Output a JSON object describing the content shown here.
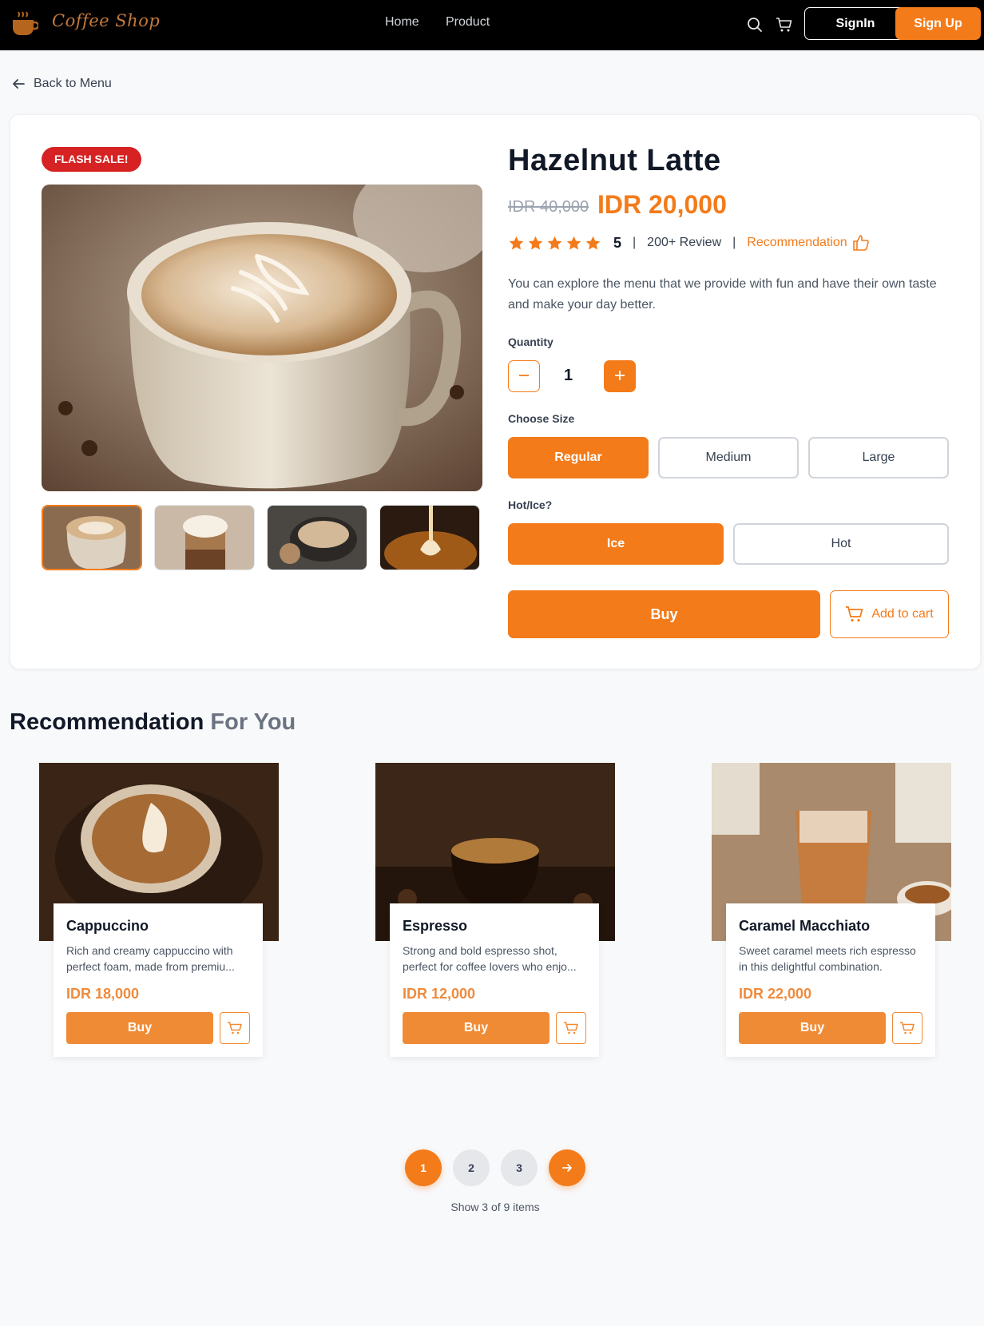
{
  "brand": {
    "name": "Coffee Shop",
    "accent": "#f37b1a"
  },
  "nav": {
    "links": [
      "Home",
      "Product"
    ],
    "signin": "SignIn",
    "signup": "Sign Up"
  },
  "back_label": "Back to Menu",
  "product": {
    "badge": "FLASH SALE!",
    "name": "Hazelnut Latte",
    "old_price": "IDR 40,000",
    "price": "IDR 20,000",
    "rating": "5",
    "reviews": "200+ Review",
    "recommendation": "Recommendation",
    "description": "You can explore the menu that we provide with fun and have their own taste and make your day better.",
    "quantity_label": "Quantity",
    "quantity": "1",
    "size_label": "Choose Size",
    "sizes": [
      "Regular",
      "Medium",
      "Large"
    ],
    "temp_label": "Hot/Ice?",
    "temps": [
      "Ice",
      "Hot"
    ],
    "buy_label": "Buy",
    "cart_label": "Add to cart"
  },
  "recommendations": {
    "title": "Recommendation",
    "title_suffix": "For You",
    "items": [
      {
        "name": "Cappuccino",
        "desc": "Rich and creamy cappuccino with perfect foam, made from premiu...",
        "price": "IDR 18,000",
        "buy": "Buy"
      },
      {
        "name": "Espresso",
        "desc": "Strong and bold espresso shot, perfect for coffee lovers who enjo...",
        "price": "IDR 12,000",
        "buy": "Buy"
      },
      {
        "name": "Caramel Macchiato",
        "desc": "Sweet caramel meets rich espresso in this delightful combination.",
        "price": "IDR 22,000",
        "buy": "Buy"
      }
    ]
  },
  "pagination": {
    "pages": [
      "1",
      "2",
      "3"
    ],
    "info": "Show 3 of 9 items"
  }
}
